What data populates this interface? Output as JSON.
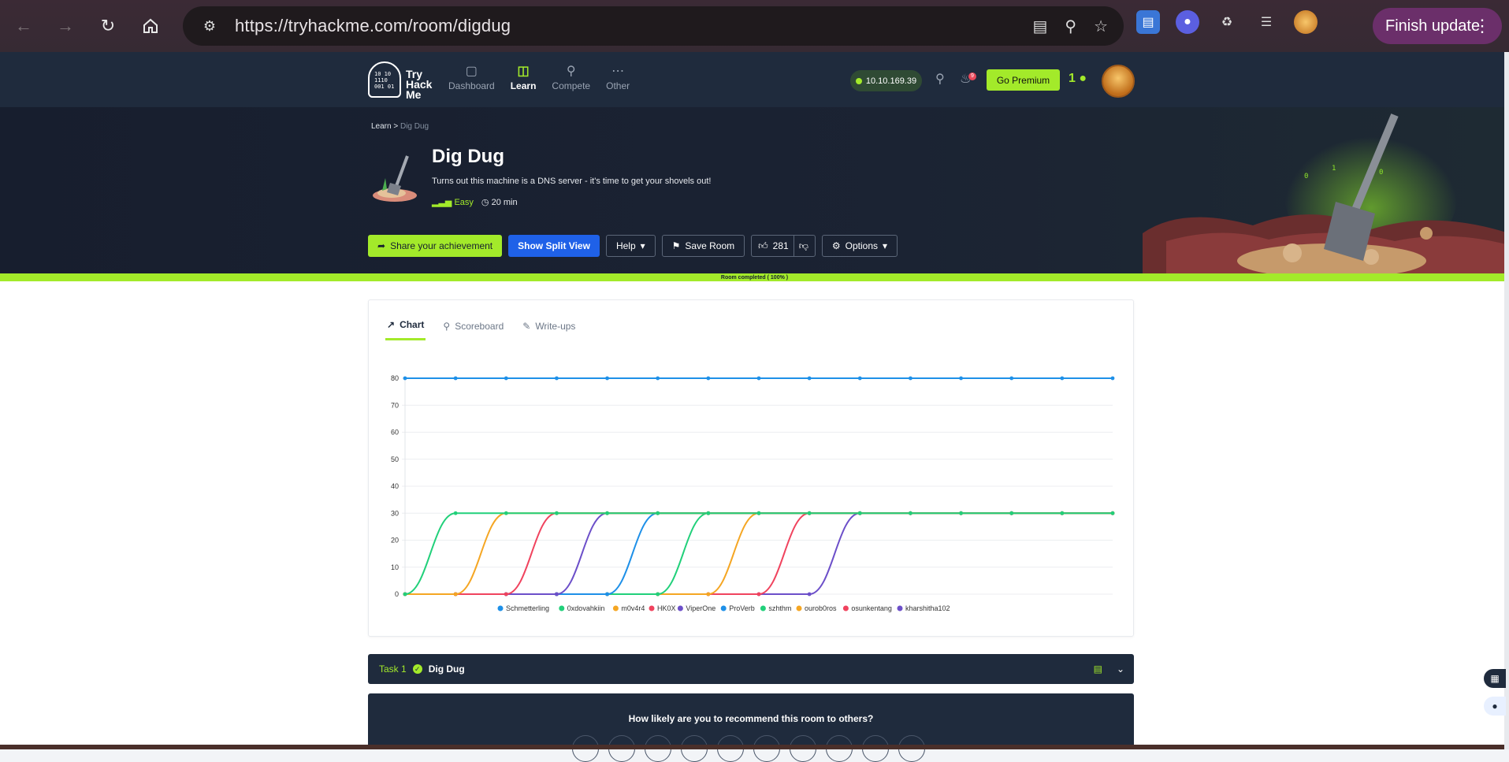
{
  "browser": {
    "url": "https://tryhackme.com/room/digdug",
    "finish_update": "Finish update"
  },
  "header": {
    "logo_text": [
      "Try",
      "Hack",
      "Me"
    ],
    "nav": [
      {
        "label": "Dashboard",
        "icon": "dashboard-icon"
      },
      {
        "label": "Learn",
        "icon": "book-icon"
      },
      {
        "label": "Compete",
        "icon": "trophy-icon"
      },
      {
        "label": "Other",
        "icon": "more-icon"
      }
    ],
    "ip": "10.10.169.39",
    "notifications": "9",
    "go_premium": "Go Premium",
    "streak": "1"
  },
  "room": {
    "breadcrumb_root": "Learn",
    "breadcrumb_sep": ">",
    "breadcrumb_current": "Dig Dug",
    "title": "Dig Dug",
    "description": "Turns out this machine is a DNS server - it's time to get your shovels out!",
    "difficulty": "Easy",
    "duration": "20 min",
    "actions": {
      "share": "Share your achievement",
      "split_view": "Show Split View",
      "help": "Help",
      "save": "Save Room",
      "likes": "281",
      "options": "Options"
    },
    "progress_label": "Room completed ( 100% )",
    "progress_value": 1.0
  },
  "tabs": [
    {
      "label": "Chart",
      "icon": "chart-icon"
    },
    {
      "label": "Scoreboard",
      "icon": "trophy-icon"
    },
    {
      "label": "Write-ups",
      "icon": "pencil-icon"
    }
  ],
  "chart_data": {
    "type": "line",
    "ylim": [
      0,
      80
    ],
    "yticks": [
      0,
      10,
      20,
      30,
      40,
      50,
      60,
      70,
      80
    ],
    "x_count": 15,
    "series": [
      {
        "name": "Schmetterling",
        "color": "#1e90e8",
        "values": [
          80,
          80,
          80,
          80,
          80,
          80,
          80,
          80,
          80,
          80,
          80,
          80,
          80,
          80,
          80
        ]
      },
      {
        "name": "0xdovahkiin",
        "color": "#21d07a",
        "values": [
          0,
          30,
          30,
          30,
          30,
          30,
          30,
          30,
          30,
          30,
          30,
          30,
          30,
          30,
          30
        ]
      },
      {
        "name": "m0v4r4",
        "color": "#f5a623",
        "values": [
          0,
          0,
          30,
          30,
          30,
          30,
          30,
          30,
          30,
          30,
          30,
          30,
          30,
          30,
          30
        ]
      },
      {
        "name": "HK0X",
        "color": "#f0435e",
        "values": [
          0,
          0,
          0,
          30,
          30,
          30,
          30,
          30,
          30,
          30,
          30,
          30,
          30,
          30,
          30
        ]
      },
      {
        "name": "ViperOne",
        "color": "#6c4fc9",
        "values": [
          0,
          0,
          0,
          0,
          30,
          30,
          30,
          30,
          30,
          30,
          30,
          30,
          30,
          30,
          30
        ]
      },
      {
        "name": "ProVerb",
        "color": "#1e90e8",
        "values": [
          0,
          0,
          0,
          0,
          0,
          30,
          30,
          30,
          30,
          30,
          30,
          30,
          30,
          30,
          30
        ]
      },
      {
        "name": "szhthm",
        "color": "#21d07a",
        "values": [
          0,
          0,
          0,
          0,
          0,
          0,
          30,
          30,
          30,
          30,
          30,
          30,
          30,
          30,
          30
        ]
      },
      {
        "name": "ourob0ros",
        "color": "#f5a623",
        "values": [
          0,
          0,
          0,
          0,
          0,
          0,
          0,
          30,
          30,
          30,
          30,
          30,
          30,
          30,
          30
        ]
      },
      {
        "name": "osunkentang",
        "color": "#f0435e",
        "values": [
          0,
          0,
          0,
          0,
          0,
          0,
          0,
          0,
          30,
          30,
          30,
          30,
          30,
          30,
          30
        ]
      },
      {
        "name": "kharshitha102",
        "color": "#6c4fc9",
        "values": [
          0,
          0,
          0,
          0,
          0,
          0,
          0,
          0,
          0,
          30,
          30,
          30,
          30,
          30,
          30
        ]
      }
    ]
  },
  "task": {
    "number": "Task 1",
    "name": "Dig Dug"
  },
  "recommend": {
    "question": "How likely are you to recommend this room to others?"
  },
  "colors": {
    "accent": "#a3ea2a",
    "navy": "#1f2b3d",
    "blue_button": "#1f61e8"
  }
}
